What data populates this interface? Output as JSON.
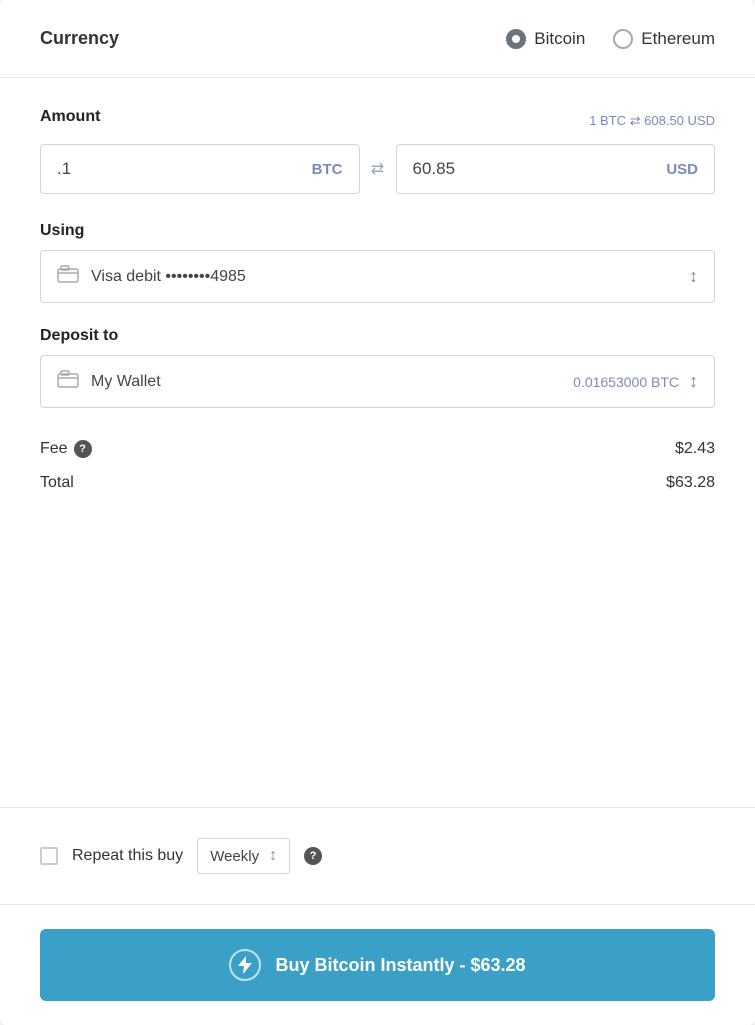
{
  "currency": {
    "label": "Currency",
    "options": [
      {
        "id": "bitcoin",
        "label": "Bitcoin",
        "selected": true
      },
      {
        "id": "ethereum",
        "label": "Ethereum",
        "selected": false
      }
    ]
  },
  "amount": {
    "label": "Amount",
    "exchange_rate": "1 BTC ⇄ 608.50 USD",
    "btc_value": ".1",
    "btc_currency": "BTC",
    "usd_value": "60.85",
    "usd_currency": "USD",
    "swap_symbol": "⇄"
  },
  "using": {
    "label": "Using",
    "icon": "🗂",
    "text": "Visa debit ••••••••4985"
  },
  "deposit": {
    "label": "Deposit to",
    "icon": "🗂",
    "text": "My Wallet",
    "balance": "0.01653000 BTC"
  },
  "fee": {
    "label": "Fee",
    "value": "$2.43"
  },
  "total": {
    "label": "Total",
    "value": "$63.28"
  },
  "repeat": {
    "label": "Repeat this buy",
    "frequency": "Weekly"
  },
  "buy_button": {
    "label": "Buy Bitcoin Instantly - $63.28",
    "bolt": "⚡"
  }
}
